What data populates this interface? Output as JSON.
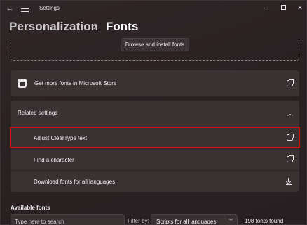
{
  "titlebar": {
    "title": "Settings",
    "back_icon": "back-arrow-icon",
    "menu_icon": "hamburger-menu-icon"
  },
  "breadcrumb": {
    "parent": "Personalization",
    "separator": "›",
    "current": "Fonts"
  },
  "install": {
    "browse_label": "Browse and install fonts"
  },
  "store_card": {
    "label": "Get more fonts in Microsoft Store",
    "icon": "store-icon",
    "action_icon": "open-external-icon"
  },
  "related": {
    "title": "Related settings",
    "collapse_icon": "chevron-up-icon",
    "items": [
      {
        "label": "Adjust ClearType text",
        "icon": "open-external-icon",
        "highlighted": true
      },
      {
        "label": "Find a character",
        "icon": "open-external-icon"
      },
      {
        "label": "Download fonts for all languages",
        "icon": "download-icon"
      }
    ]
  },
  "available": {
    "title": "Available fonts",
    "search_placeholder": "Type here to search",
    "filter_label": "Filter by:",
    "filter_value": "Scripts for all languages",
    "count_text": "198 fonts found"
  },
  "colors": {
    "highlight": "#d40f14",
    "card": "#3a3133",
    "background": "#2b2224"
  }
}
